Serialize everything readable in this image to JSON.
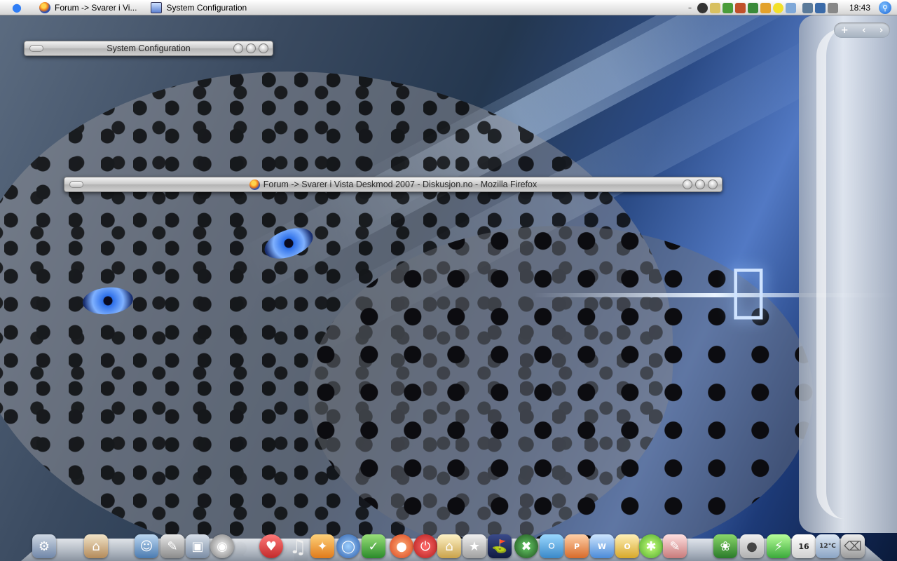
{
  "menubar": {
    "apple_menu": "apple-icon",
    "tasks": [
      {
        "label": "Forum -> Svarer i Vi...",
        "icon": "firefox-icon"
      },
      {
        "label": "System Configuration",
        "icon": "system-config-icon"
      }
    ],
    "tray_minimize": "–",
    "clock": "18:43",
    "spotlight_icon": "magnifier-icon"
  },
  "windows": {
    "system_config": {
      "title": "System Configuration"
    },
    "firefox": {
      "title": "Forum -> Svarer i Vista Deskmod 2007 - Diskusjon.no - Mozilla Firefox"
    }
  },
  "panel": {
    "add": "+",
    "prev": "‹",
    "next": "›"
  },
  "dock": {
    "calendar_day": "16",
    "weather_temp": "12°C"
  },
  "colors": {
    "accent": "#2f7df5",
    "wallpaper_blue": "#2b4b86"
  }
}
